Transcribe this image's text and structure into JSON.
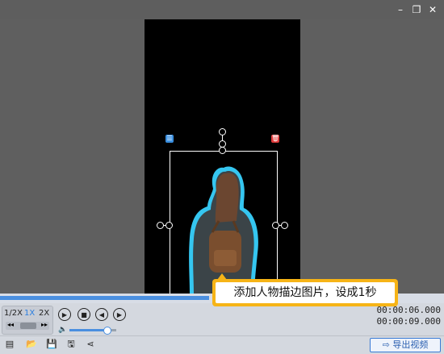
{
  "window": {
    "controls": [
      "minimize",
      "restore",
      "close"
    ]
  },
  "speed": {
    "options": [
      "1/2X",
      "1X",
      "2X"
    ],
    "selected": "1X"
  },
  "timecode": {
    "current": "00:00:06.000",
    "total": "00:00:09.000"
  },
  "progress": {
    "played_fraction": 0.47
  },
  "volume": {
    "level_fraction": 0.8
  },
  "export": {
    "label": "导出视频"
  },
  "tooltip": {
    "text": "添加人物描边图片，设成1秒"
  },
  "colors": {
    "accent": "#4a8fe0",
    "tooltip_border": "#f6b417",
    "outline_glow": "#35c6f0",
    "badge_blue": "#3a8fe0",
    "badge_red": "#e03a3a"
  },
  "icons": {
    "toolbar": [
      "adjust-icon",
      "open-folder-icon",
      "save-icon",
      "save-as-icon",
      "share-icon"
    ],
    "playback": [
      "play-icon",
      "stop-icon",
      "prev-frame-icon",
      "next-frame-icon"
    ]
  }
}
